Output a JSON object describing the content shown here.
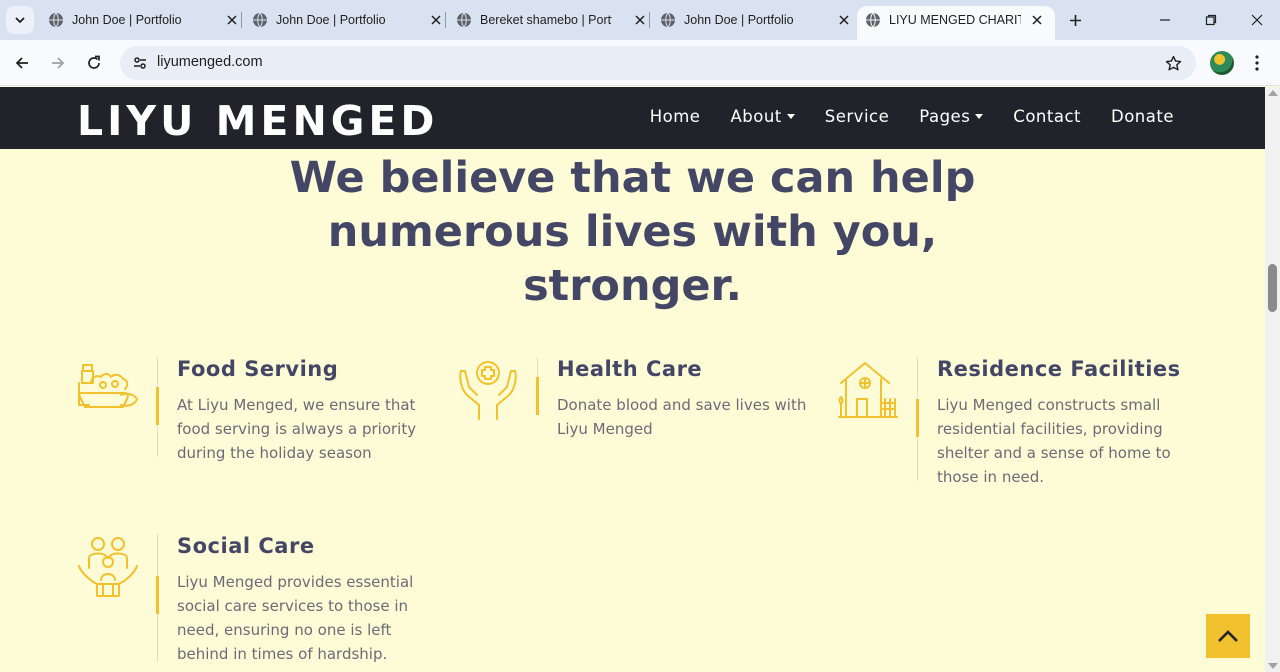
{
  "browser": {
    "tabs": [
      {
        "title": "John Doe | Portfolio",
        "active": false
      },
      {
        "title": "John Doe | Portfolio",
        "active": false
      },
      {
        "title": "Bereket shamebo | Portfolio",
        "active": false
      },
      {
        "title": "John Doe | Portfolio",
        "active": false
      },
      {
        "title": "LIYU MENGED CHARITY",
        "active": true
      }
    ],
    "url": "liyumenged.com"
  },
  "site": {
    "brand": "LIYU MENGED",
    "nav": {
      "home": "Home",
      "about": "About",
      "service": "Service",
      "pages": "Pages",
      "contact": "Contact",
      "donate": "Donate"
    },
    "headline": {
      "line1": "We believe that we can help",
      "line2": "numerous lives with you,",
      "line3": "stronger."
    },
    "features": [
      {
        "title": "Food Serving",
        "text": "At Liyu Menged, we ensure that food serving is always a priority during the holiday season",
        "icon": "food-icon"
      },
      {
        "title": "Health Care",
        "text": "Donate blood and save lives with Liyu Menged",
        "icon": "health-care-icon"
      },
      {
        "title": "Residence Facilities",
        "text": "Liyu Menged constructs small residential facilities, providing shelter and a sense of home to those in need.",
        "icon": "house-icon"
      },
      {
        "title": "Social Care",
        "text": "Liyu Menged provides essential social care services to those in need, ensuring no one is left behind in times of hardship.",
        "icon": "family-icon"
      }
    ]
  },
  "colors": {
    "navbar": "#22222b",
    "background": "#fefcd6",
    "accent": "#f2c12e",
    "heading": "#444666"
  }
}
